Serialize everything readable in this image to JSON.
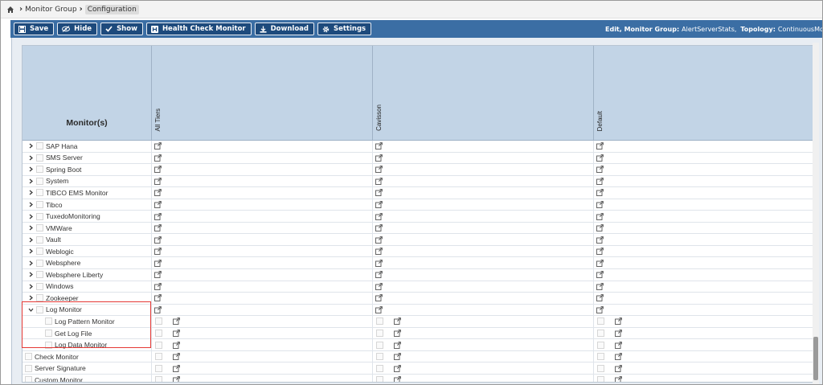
{
  "breadcrumb": {
    "items": [
      "Monitor Group",
      "Configuration"
    ]
  },
  "toolbar": {
    "buttons": [
      {
        "label": "Save",
        "icon": "floppy-icon"
      },
      {
        "label": "Hide",
        "icon": "eye-slash-icon"
      },
      {
        "label": "Show",
        "icon": "check-icon"
      },
      {
        "label": "Health Check Monitor",
        "icon": "h-square-icon"
      },
      {
        "label": "Download",
        "icon": "download-icon"
      },
      {
        "label": "Settings",
        "icon": "gear-icon"
      }
    ],
    "info": {
      "edit_label": "Edit, Monitor Group:",
      "group": "AlertServerStats,",
      "topology_label": "Topology:",
      "topology": "ContinuousMonitorin"
    }
  },
  "table": {
    "first_header": "Monitor(s)",
    "tiers": [
      "All Tiers",
      "Cavisson",
      "Default"
    ],
    "rows": [
      {
        "name": "SAP Hana",
        "type": "collapsed"
      },
      {
        "name": "SMS Server",
        "type": "collapsed"
      },
      {
        "name": "Spring Boot",
        "type": "collapsed"
      },
      {
        "name": "System",
        "type": "collapsed"
      },
      {
        "name": "TIBCO EMS Monitor",
        "type": "collapsed"
      },
      {
        "name": "Tibco",
        "type": "collapsed"
      },
      {
        "name": "TuxedoMonitoring",
        "type": "collapsed"
      },
      {
        "name": "VMWare",
        "type": "collapsed"
      },
      {
        "name": "Vault",
        "type": "collapsed"
      },
      {
        "name": "Weblogic",
        "type": "collapsed"
      },
      {
        "name": "Websphere",
        "type": "collapsed"
      },
      {
        "name": "Websphere Liberty",
        "type": "collapsed"
      },
      {
        "name": "Windows",
        "type": "collapsed"
      },
      {
        "name": "Zookeeper",
        "type": "collapsed"
      },
      {
        "name": "Log Monitor",
        "type": "expanded"
      },
      {
        "name": "Log Pattern Monitor",
        "type": "child"
      },
      {
        "name": "Get Log File",
        "type": "child"
      },
      {
        "name": "Log Data Monitor",
        "type": "child"
      },
      {
        "name": "Check Monitor",
        "type": "leaf"
      },
      {
        "name": "Server Signature",
        "type": "leaf"
      },
      {
        "name": "Custom Monitor",
        "type": "leaf"
      }
    ]
  },
  "colors": {
    "toolbar": "#3b6ea4",
    "button": "#1d4a7c",
    "header": "#c2d4e6",
    "highlight": "#e53935"
  }
}
